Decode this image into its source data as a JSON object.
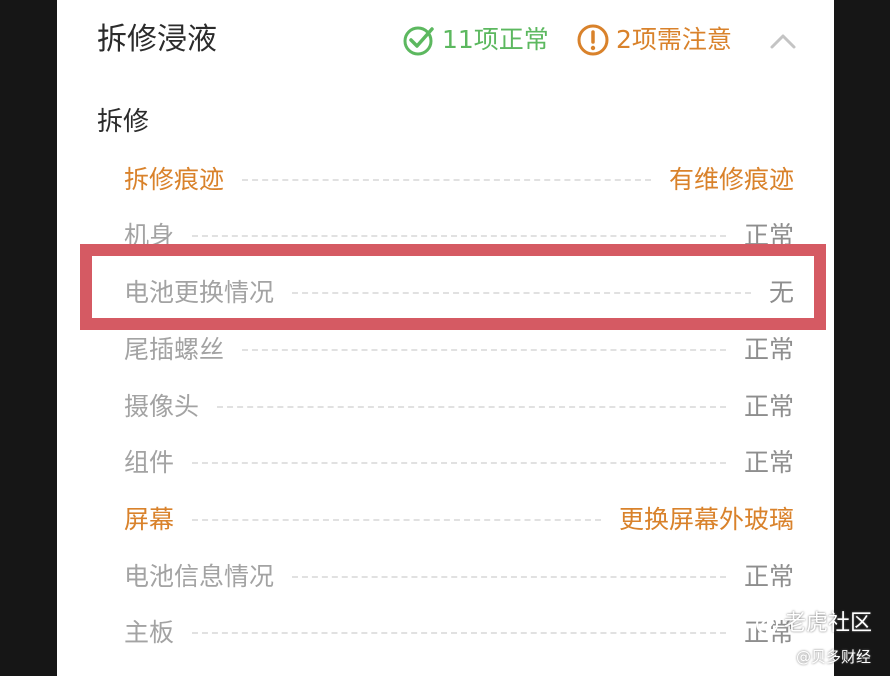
{
  "header": {
    "title": "拆修浸液",
    "ok_summary": "11项正常",
    "warn_summary": "2项需注意",
    "collapse_icon": "chevron-up-icon"
  },
  "section": {
    "title": "拆修",
    "items": [
      {
        "label": "拆修痕迹",
        "value": "有维修痕迹",
        "status": "warn"
      },
      {
        "label": "机身",
        "value": "正常",
        "status": "normal"
      },
      {
        "label": "电池更换情况",
        "value": "无",
        "status": "normal"
      },
      {
        "label": "尾插螺丝",
        "value": "正常",
        "status": "normal"
      },
      {
        "label": "摄像头",
        "value": "正常",
        "status": "normal"
      },
      {
        "label": "组件",
        "value": "正常",
        "status": "normal"
      },
      {
        "label": "屏幕",
        "value": "更换屏幕外玻璃",
        "status": "warn"
      },
      {
        "label": "电池信息情况",
        "value": "正常",
        "status": "normal"
      },
      {
        "label": "主板",
        "value": "正常",
        "status": "normal"
      }
    ]
  },
  "watermark": {
    "line1": "老虎社区",
    "line2": "@贝多财经"
  },
  "colors": {
    "ok": "#5cb85f",
    "warn": "#d9822b",
    "highlight_border": "#d55a63",
    "muted_text": "#a3a3a3"
  }
}
